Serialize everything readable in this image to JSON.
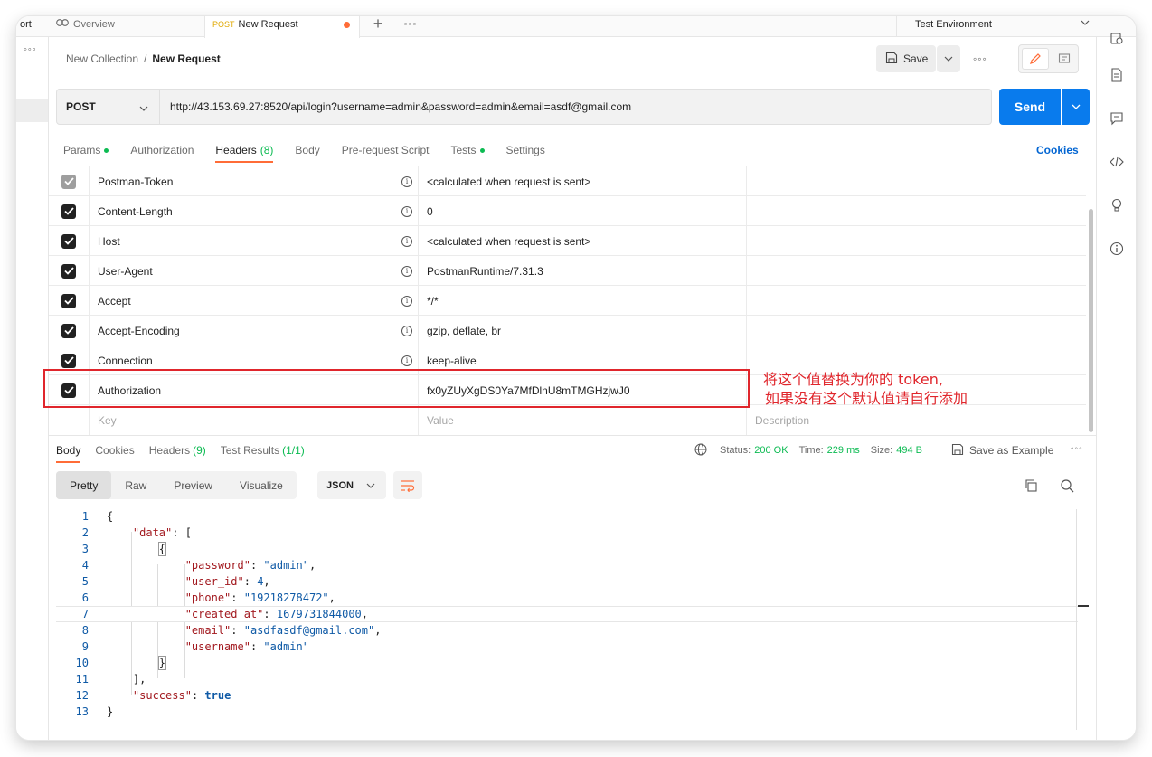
{
  "tabs": {
    "partial_left": "ort",
    "overview": "Overview",
    "active_method": "POST",
    "active_title": "New Request",
    "environment": "Test Environment"
  },
  "breadcrumb": {
    "collection": "New Collection",
    "separator": "/",
    "request": "New Request"
  },
  "toolbar": {
    "save_label": "Save"
  },
  "request": {
    "method": "POST",
    "url": "http://43.153.69.27:8520/api/login?username=admin&password=admin&email=asdf@gmail.com",
    "send_label": "Send"
  },
  "request_tabs": {
    "params": "Params",
    "authorization": "Authorization",
    "headers": "Headers",
    "headers_count": "(8)",
    "body": "Body",
    "prerequest": "Pre-request Script",
    "tests": "Tests",
    "settings": "Settings",
    "cookies": "Cookies"
  },
  "headers": [
    {
      "key": "Postman-Token",
      "value": "<calculated when request is sent>"
    },
    {
      "key": "Content-Length",
      "value": "0"
    },
    {
      "key": "Host",
      "value": "<calculated when request is sent>"
    },
    {
      "key": "User-Agent",
      "value": "PostmanRuntime/7.31.3"
    },
    {
      "key": "Accept",
      "value": "*/*"
    },
    {
      "key": "Accept-Encoding",
      "value": "gzip, deflate, br"
    },
    {
      "key": "Connection",
      "value": "keep-alive"
    },
    {
      "key": "Authorization",
      "value": "fx0yZUyXgDS0Ya7MfDlnU8mTMGHzjwJ0"
    }
  ],
  "header_placeholders": {
    "key": "Key",
    "value": "Value",
    "description": "Description"
  },
  "annotation": {
    "line1": "将这个值替换为你的 token,",
    "line2": "如果没有这个默认值请自行添加"
  },
  "response_tabs": {
    "body": "Body",
    "cookies": "Cookies",
    "headers": "Headers",
    "headers_count": "(9)",
    "test_results": "Test Results",
    "test_count": "(1/1)"
  },
  "response_meta": {
    "status_label": "Status:",
    "status_value": "200 OK",
    "time_label": "Time:",
    "time_value": "229 ms",
    "size_label": "Size:",
    "size_value": "494 B",
    "save_example": "Save as Example"
  },
  "view_modes": [
    "Pretty",
    "Raw",
    "Preview",
    "Visualize"
  ],
  "format": "JSON",
  "response_body": {
    "password": "\"admin\"",
    "user_id": "4",
    "phone": "\"19218278472\"",
    "created_at": "1679731844000",
    "email": "\"asdfasdf@gmail.com\"",
    "username": "\"admin\"",
    "success": "true"
  },
  "colors": {
    "accent": "#ff6c37",
    "send": "#097bed",
    "annotation": "#e0262c",
    "ok": "#0cbb52"
  }
}
